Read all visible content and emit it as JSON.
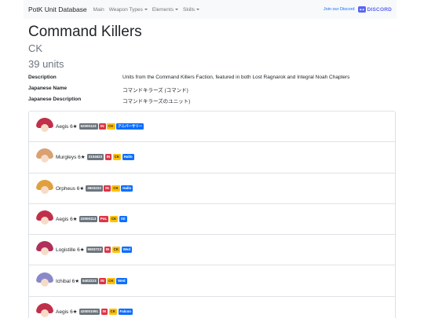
{
  "nav": {
    "brand": "PotK Unit Database",
    "links": [
      "Main",
      "Weapon Types",
      "Elements",
      "Skills"
    ],
    "join": "Join our Discord",
    "discord": "DISCORD"
  },
  "page": {
    "title": "Command Killers",
    "abbr": "CK",
    "count": "39 units"
  },
  "info": [
    {
      "label": "Description",
      "value": "Units from the Command Killers Faction, featured in both Lost Ragnarok and Integral Noah Chapters"
    },
    {
      "label": "Japanese Name",
      "value": "コマンドキラーズ (コマンド)"
    },
    {
      "label": "Japanese Description",
      "value": "コマンドキラーズのユニット)"
    }
  ],
  "units": [
    {
      "name": "Aegis 6★",
      "id": "52000123",
      "type": "IN",
      "faction": "CK",
      "element": "アニバーサリー",
      "hair": "#c0304a"
    },
    {
      "name": "Murgleys 6★",
      "id": "3104623",
      "type": "IN",
      "faction": "CK",
      "element": "Hallo",
      "hair": "#d9a070"
    },
    {
      "name": "Orpheus 6★",
      "id": "3603223",
      "type": "IN",
      "faction": "CK",
      "element": "Hallo",
      "hair": "#e0a040"
    },
    {
      "name": "Aegis 6★",
      "id": "22000113",
      "type": "PoL",
      "faction": "CK",
      "element": "Sti",
      "hair": "#c0304a"
    },
    {
      "name": "Logistille 6★",
      "id": "5503723",
      "type": "IN",
      "faction": "CK",
      "element": "Wed",
      "hair": "#b0305a"
    },
    {
      "name": "Ichibal 6★",
      "id": "5402223",
      "type": "IN",
      "faction": "CK",
      "element": "Wed",
      "hair": "#8a88c8"
    },
    {
      "name": "Aegis 6★",
      "id": "420001091",
      "type": "IN",
      "faction": "CK",
      "element": "Falcon",
      "hair": "#c0304a"
    }
  ]
}
